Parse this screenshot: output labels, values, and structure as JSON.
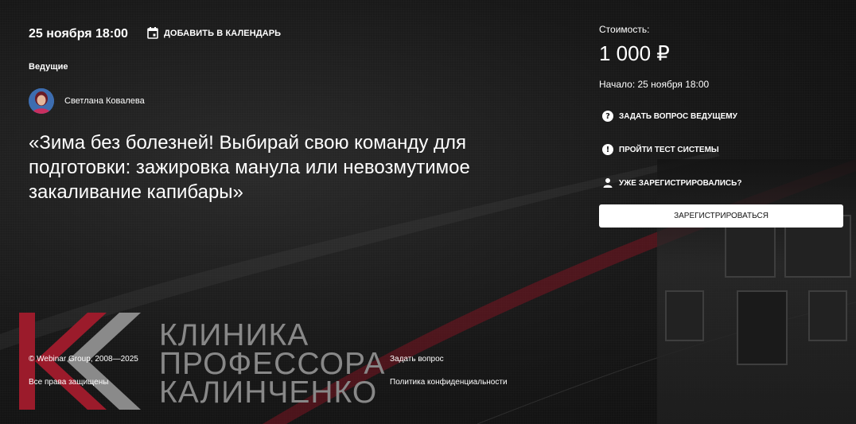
{
  "event": {
    "date": "25 ноября 18:00",
    "add_to_calendar": "ДОБАВИТЬ В КАЛЕНДАРЬ",
    "hosts_label": "Ведущие",
    "host_name": "Светлана Ковалева",
    "title": "«Зима без болезней! Выбирай свою команду для подготовки: зажировка манула или невозмутимое закаливание капибары»"
  },
  "sidebar": {
    "price_label": "Стоимость:",
    "price": "1 000 ₽",
    "start": "Начало: 25 ноября 18:00",
    "actions": [
      {
        "icon": "question-icon",
        "label": "ЗАДАТЬ ВОПРОС ВЕДУЩЕМУ"
      },
      {
        "icon": "exclamation-icon",
        "label": "ПРОЙТИ ТЕСТ СИСТЕМЫ"
      },
      {
        "icon": "person-icon",
        "label": "УЖЕ ЗАРЕГИСТРИРОВАЛИСЬ?"
      }
    ],
    "register_button": "ЗАРЕГИСТРИРОВАТЬСЯ"
  },
  "logo": {
    "lines": [
      "КЛИНИКА",
      "ПРОФЕССОРА",
      "КАЛИНЧЕНКО"
    ]
  },
  "footer": {
    "copyright": "© Webinar Group, 2008—2025",
    "rights": "Все права защищены",
    "ask": "Задать вопрос",
    "privacy": "Политика конфиденциальности"
  },
  "colors": {
    "background": "#141414",
    "accent_red": "#9b1b2b",
    "button_bg": "#ffffff"
  }
}
